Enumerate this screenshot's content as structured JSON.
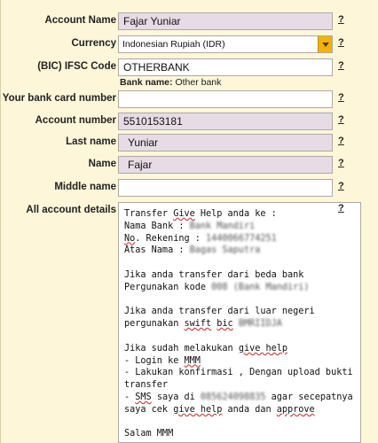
{
  "form": {
    "help_text": "?",
    "account_name": {
      "label": "Account Name",
      "value": "Fajar Yuniar"
    },
    "currency": {
      "label": "Currency",
      "value": "Indonesian Rupiah (IDR)"
    },
    "ifsc": {
      "label": "(BIC) IFSC Code",
      "value": "OTHERBANK",
      "bank_name_label": "Bank name:",
      "bank_name_value": "Other bank"
    },
    "card_number": {
      "label": "Your bank card number",
      "value": ""
    },
    "account_number": {
      "label": "Account number",
      "value": "5510153181"
    },
    "last_name": {
      "label": "Last name",
      "value": "Yuniar"
    },
    "name": {
      "label": "Name",
      "value": "Fajar"
    },
    "middle_name": {
      "label": "Middle name",
      "value": ""
    },
    "details": {
      "label": "All account details",
      "line1": "Transfer ",
      "line1_b": "Give",
      "line1_c": " Help anda ke :",
      "line2": "Nama Bank : ",
      "line2_blur": "Bank Mandiri",
      "line3_a": "No",
      "line3_b": ". Rekening : ",
      "line3_blur": "1440066774251",
      "line4": "Atas Nama : ",
      "line4_blur": "Bagas Saputra",
      "line6": "Jika anda transfer dari beda bank",
      "line7": "Pergunakan kode ",
      "line7_blur": "008 (Bank Mandiri)",
      "line9": "Jika anda transfer dari luar negeri",
      "line10_a": "pergunakan ",
      "line10_b": "swift",
      "line10_c": " ",
      "line10_d": "bic",
      "line10_e": " ",
      "line10_blur": "BMRIIDJA",
      "line12_a": "Jika sudah melakukan ",
      "line12_b": "give help",
      "line13_a": "- Login ke ",
      "line13_b": "MMM",
      "line14": "- Lakukan konfirmasi , Dengan upload bukti",
      "line15": "transfer",
      "line16_a": "- ",
      "line16_b": "SMS",
      "line16_c": " saya di ",
      "line16_blur": "085624098835",
      "line16_d": " agar secepatnya",
      "line17_a": "saya cek ",
      "line17_b": "give help",
      "line17_c": " anda dan ",
      "line17_d": "approve",
      "line19": "Salam MMM"
    }
  },
  "colors": {
    "background": "#fdf6d9",
    "filled_field": "#e7dce6",
    "select_arrow": "#f2b400"
  }
}
